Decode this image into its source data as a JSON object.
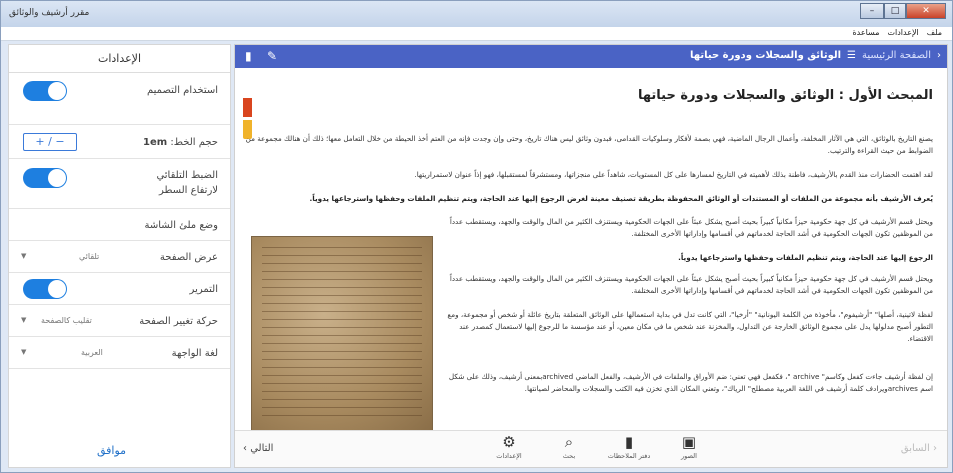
{
  "window": {
    "title": "مقرر أرشيف والوثائق"
  },
  "menu": {
    "items": [
      "ملف",
      "الإعدادات",
      "مساعدة"
    ]
  },
  "settings": {
    "title": "الإعدادات",
    "use_design": "استخدام التصميم",
    "font_size_label": "حجم الخط:",
    "font_size_value": "1em",
    "stepper": "+ / −",
    "auto_line_height": "الضبط التلقائي لارتفاع السطر",
    "screen_mode": "وضع ملئ الشاشة",
    "page_view_label": "عرض الصفحة",
    "page_view_value": "تلقائي",
    "scroll": "التمرير",
    "page_turn_label": "حركة تغيير الصفحة",
    "page_turn_value": "تقليب كالصفحة",
    "ui_lang_label": "لغة الواجهة",
    "ui_lang_value": "العربية",
    "ok": "موافق"
  },
  "reader": {
    "breadcrumb_home": "الصفحة الرئيسية",
    "breadcrumb_title": "الوثائق والسجلات ودورة حياتها",
    "heading": "المبحث الأول : الوثائق والسجلات ودورة حياتها",
    "p1": "يصنع التاريخ بالوثائق، التي هي الآثار المخلفة، وأعمال الرجال الماضية، فهي بصمة لأفكار وسلوكيات القدامى، فبدون وثائق ليس هناك تاريخ، وحتى وإن وجدت فإنه من العتم أخذ الحيطة من خلال التعامل معها؛ ذلك أن هنالك مجموعة من الضوابط من حيث القراءة والترتيب.",
    "p2": "لقد اهتمت الحضارات منذ القدم بالأرشيف، فاطنة بذلك لأهميته في التاريخ لمسارها على كل المستويات، شاهداً على منجزاتها، ومستشرقاً لمستقبلها، فهو إذاً عنوان لاستمراريتها.",
    "p3": "يُعرف الأرشيف بأنه مجموعة من الملفات أو المستندات أو الوثائق المحفوظة بطريقة تصنيف معينة لغرض الرجوع إليها عند الحاجة، ويتم تنظيم الملفات وحفظها واسترجاعها يدوياً.",
    "p4": "ويحتل قسم الأرشيف في كل جهة حكومية حيزاً مكانياً كبيراً بحيث أصبح يشكل عبئاً على الجهات الحكومية ويستنزف الكثير من المال والوقت والجهد، ويستقطب عدداً من الموظفين تكون الجهات الحكومية في أشد الحاجة لخدماتهم في أقسامها وإداراتها الأخرى المختلفة.",
    "p5": "الرجوع إليها عند الحاجة، ويتم تنظيم الملفات وحفظها واسترجاعها يدوياً.",
    "p6": "ويحتل قسم الأرشيف في كل جهة حكومية حيزاً مكانياً كبيراً بحيث أصبح يشكل عبئاً على الجهات الحكومية ويستنزف الكثير من المال والوقت والجهد، ويستقطب عدداً من الموظفين تكون الجهات الحكومية في أشد الحاجة لخدماتهم في أقسامها وإداراتها الأخرى المختلفة.",
    "p7": "لفظة لاتينية، أصلها\" \"أرشيفوم\"، مأخوذة من الكلمة اليونانية\" \"أرخيا\"، التي كانت تدل في بداية استعمالها على الوثائق المتعلقة بتاريخ عائلة أو شخص أو مجموعة، ومع التطور أصبح مدلولها يدل على مجموع الوثائق الخارجة عن التداول، والمخزنة عند شخص ما في مكان معين، أو عند مؤسسة ما للرجوع إليها لاستعمال كمصدر عند الاقتضاء.",
    "p8": "إن لفظة أرشيف جاءت كفعل وكاسم\" archive \"، فكفعل فهي تعني: ضم الأوراق والملفات في الأرشيف، والفعل الماضي archivedبمعنى أرشيف، وذلك على شكل اسم archivesويرادف كلمة أرشيف في اللغة العربية مصطلح\" الرياك\"، وتعني المكان الذي تخزن فيه الكتب والسجلات والمحاضر لصيانتها."
  },
  "bottom": {
    "next": "التالي",
    "prev": "السابق",
    "settings": "الإعدادات",
    "search": "بحث",
    "notes": "دفتر الملاحظات",
    "images": "الصور"
  },
  "colors": {
    "accent": "#4a63c5",
    "toggle": "#1e7fe0",
    "bookmark_red": "#d9451f",
    "bookmark_yellow": "#f0b32b"
  }
}
